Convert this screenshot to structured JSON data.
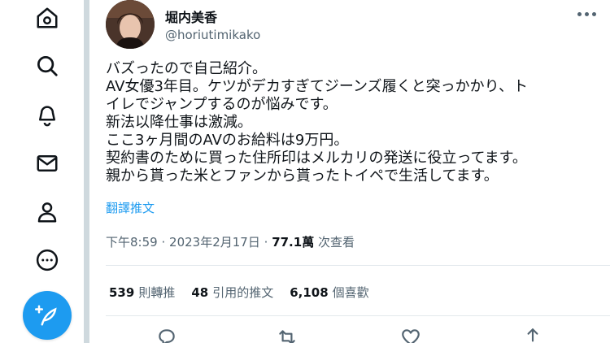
{
  "sidebar": {
    "nav": [
      {
        "icon": "home-icon"
      },
      {
        "icon": "search-icon"
      },
      {
        "icon": "bell-icon"
      },
      {
        "icon": "mail-icon"
      },
      {
        "icon": "profile-icon"
      },
      {
        "icon": "more-circle-icon"
      }
    ],
    "compose_icon": "feather-plus-icon",
    "accent": "#1d9bf0"
  },
  "tweet": {
    "author": {
      "display_name": "堀内美香",
      "handle": "@horiutimikako"
    },
    "text_lines": [
      "バズったので自己紹介。",
      "AV女優3年目。ケツがデカすぎてジーンズ履くと突っかかり、ト",
      "イレでジャンプするのが悩みです。",
      "新法以降仕事は激減。",
      "ここ3ヶ月間のAVのお給料は9万円。",
      "契約書のために買った住所印はメルカリの発送に役立ってます。",
      "親から貰った米とファンから貰ったトイペで生活してます。"
    ],
    "translate_label": "翻譯推文",
    "time": "下午8:59",
    "separator": "·",
    "date": "2023年2月17日",
    "views_count": "77.1萬",
    "views_label": "次查看",
    "stats": {
      "retweets_count": "539",
      "retweets_label": "則轉推",
      "quotes_count": "48",
      "quotes_label": "引用的推文",
      "likes_count": "6,108",
      "likes_label": "個喜歡"
    },
    "actions": [
      "reply-icon",
      "retweet-icon",
      "like-icon",
      "share-icon"
    ]
  }
}
